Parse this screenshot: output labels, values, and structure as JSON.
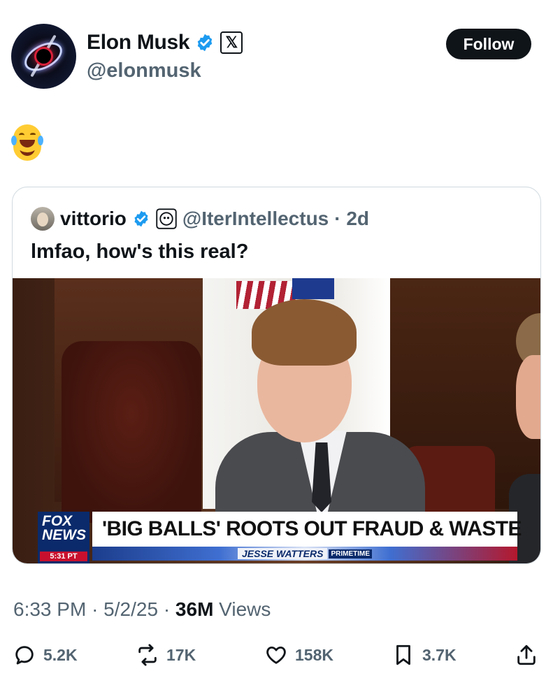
{
  "author": {
    "display_name": "Elon Musk",
    "handle": "@elonmusk",
    "x_badge": "𝕏"
  },
  "follow_label": "Follow",
  "tweet_text": "😂",
  "quoted": {
    "display_name": "vittorio",
    "handle": "@IterIntellectus",
    "age": "· 2d",
    "text": "lmfao, how's this real?",
    "media": {
      "network": "FOX\nNEWS",
      "time": "5:31 PT",
      "headline": "'BIG BALLS' ROOTS OUT FRAUD & WASTE",
      "show": "JESSE WATTERS",
      "show_tag": "PRIMETIME"
    }
  },
  "meta": {
    "time": "6:33 PM",
    "date": "5/2/25",
    "views_count": "36M",
    "views_label": "Views"
  },
  "actions": {
    "replies": "5.2K",
    "reposts": "17K",
    "likes": "158K",
    "bookmarks": "3.7K"
  },
  "colors": {
    "verified_blue": "#1d9bf0",
    "text_primary": "#0f1419",
    "text_secondary": "#536471",
    "border": "#cfd9de"
  },
  "icons": [
    "verified-badge-icon",
    "x-logo-icon",
    "reply-icon",
    "repost-icon",
    "like-icon",
    "bookmark-icon",
    "share-icon"
  ]
}
